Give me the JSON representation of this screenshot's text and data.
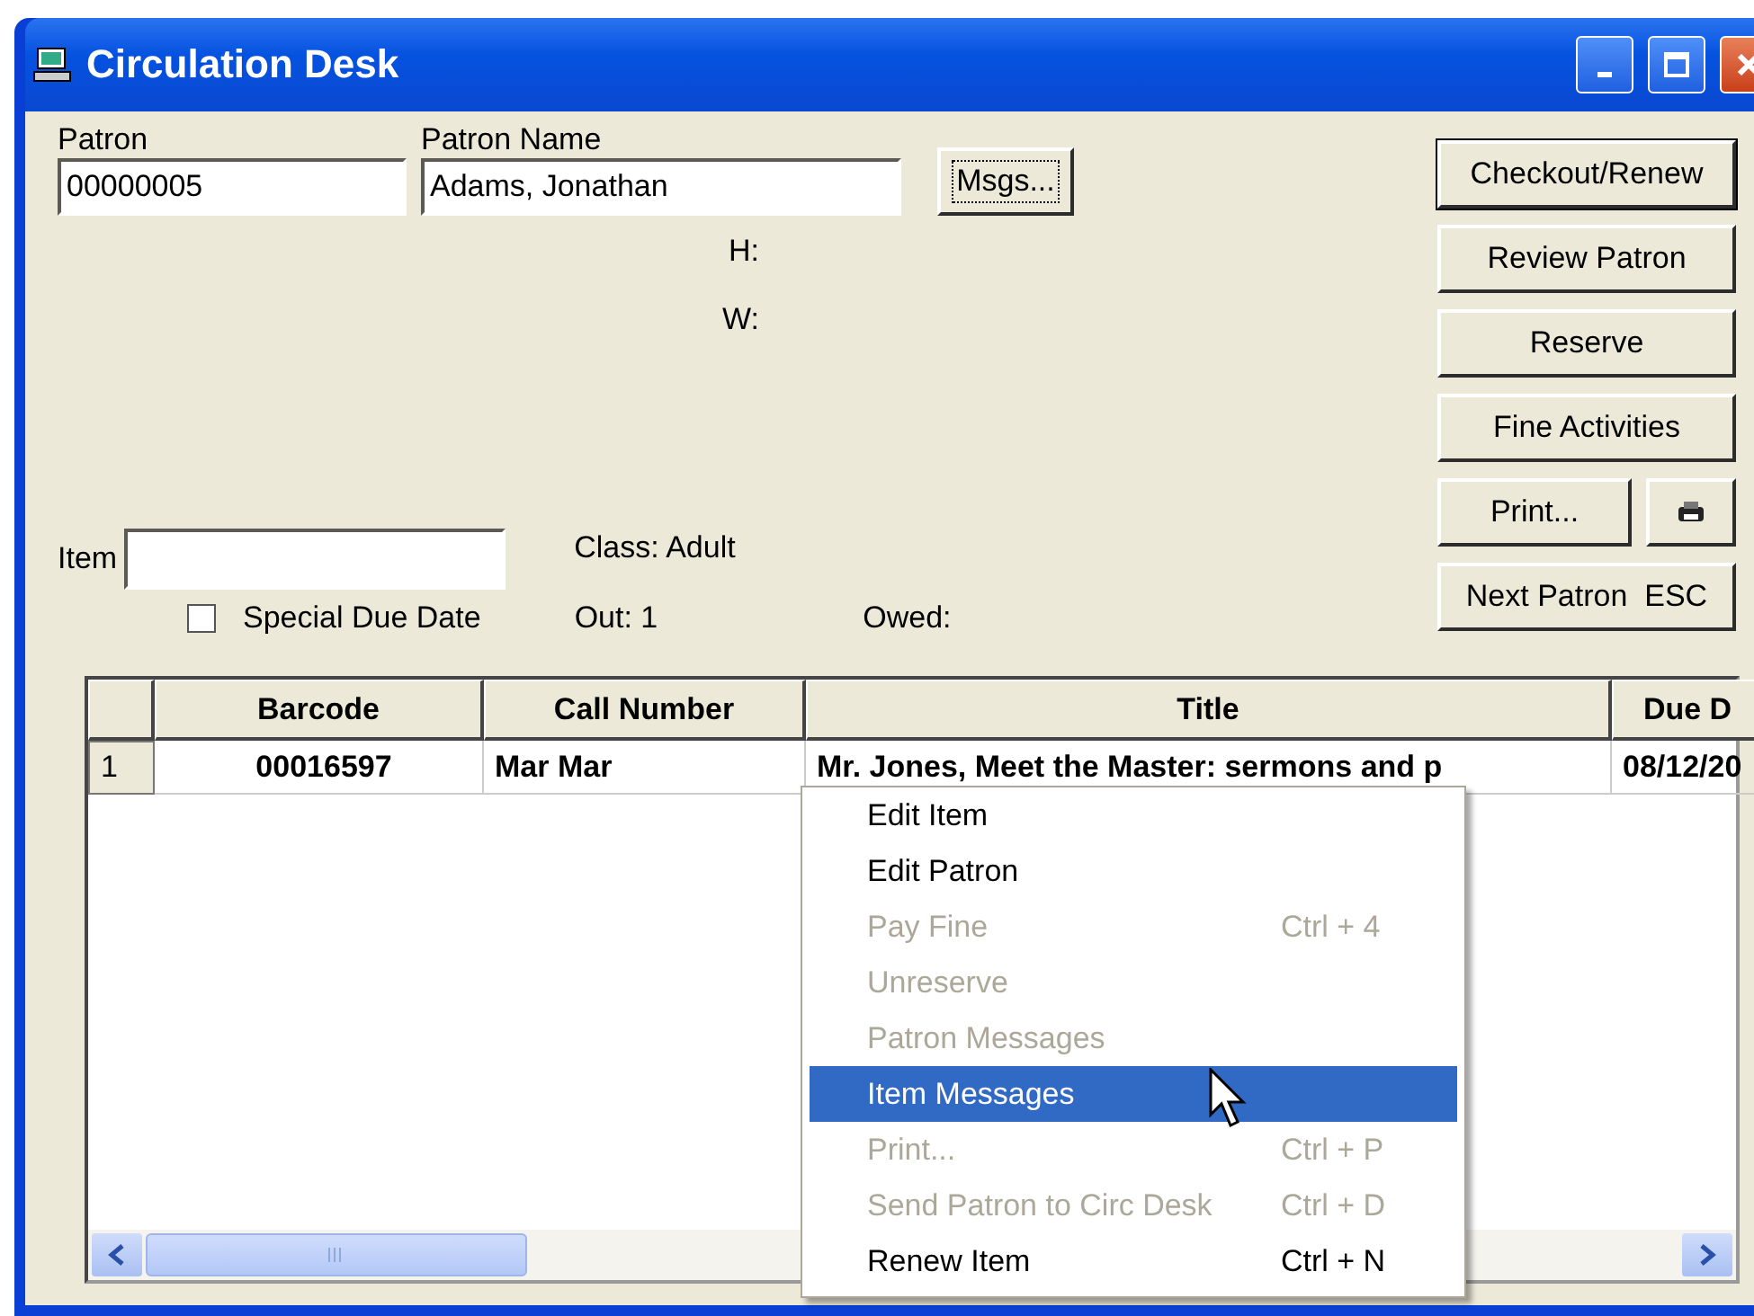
{
  "window": {
    "title": "Circulation Desk"
  },
  "patron": {
    "label": "Patron",
    "value": "00000005"
  },
  "patron_name": {
    "label": "Patron Name",
    "value": "Adams, Jonathan"
  },
  "msgs_button": {
    "label": "Msgs...",
    "focused": true
  },
  "phones": [
    "H:",
    "W:"
  ],
  "item": {
    "label": "Item"
  },
  "class_text": "Class: Adult",
  "special_due_date": {
    "label": "Special Due Date",
    "checked": false
  },
  "out_text": "Out: 1",
  "owed_text": "Owed:",
  "right_buttons": [
    {
      "kind": "button",
      "label": "Checkout/Renew",
      "default": true
    },
    {
      "kind": "button",
      "label": "Review Patron",
      "default": false
    },
    {
      "kind": "button",
      "label": "Reserve",
      "default": false
    },
    {
      "kind": "button",
      "label": "Fine Activities",
      "default": false
    },
    {
      "kind": "with_icon",
      "label": "Print...",
      "default": false
    },
    {
      "kind": "button",
      "label": "Next Patron  ESC",
      "default": false
    }
  ],
  "table": {
    "columns": [
      "Barcode",
      "Call Number",
      "Title",
      "Due D"
    ],
    "rows": [
      {
        "number": "1",
        "cells": [
          "00016597",
          "Mar Mar",
          "Mr. Jones, Meet the Master: sermons and p",
          "08/12/20"
        ]
      }
    ]
  },
  "context_menu": [
    {
      "label": "Edit Item",
      "disabled": false,
      "selected": false
    },
    {
      "label": "Edit Patron",
      "disabled": false,
      "selected": false
    },
    {
      "label": "Pay Fine",
      "shortcut": "Ctrl + 4",
      "disabled": true,
      "selected": false
    },
    {
      "label": "Unreserve",
      "disabled": true,
      "selected": false
    },
    {
      "label": "Patron Messages",
      "disabled": true,
      "selected": false
    },
    {
      "label": "Item Messages",
      "disabled": false,
      "selected": true
    },
    {
      "label": "Print...",
      "shortcut": "Ctrl + P",
      "disabled": true,
      "selected": false
    },
    {
      "label": "Send Patron to Circ Desk",
      "shortcut": "Ctrl + D",
      "disabled": true,
      "selected": false
    },
    {
      "label": "Renew Item",
      "shortcut": "Ctrl + N",
      "disabled": false,
      "selected": false
    }
  ]
}
